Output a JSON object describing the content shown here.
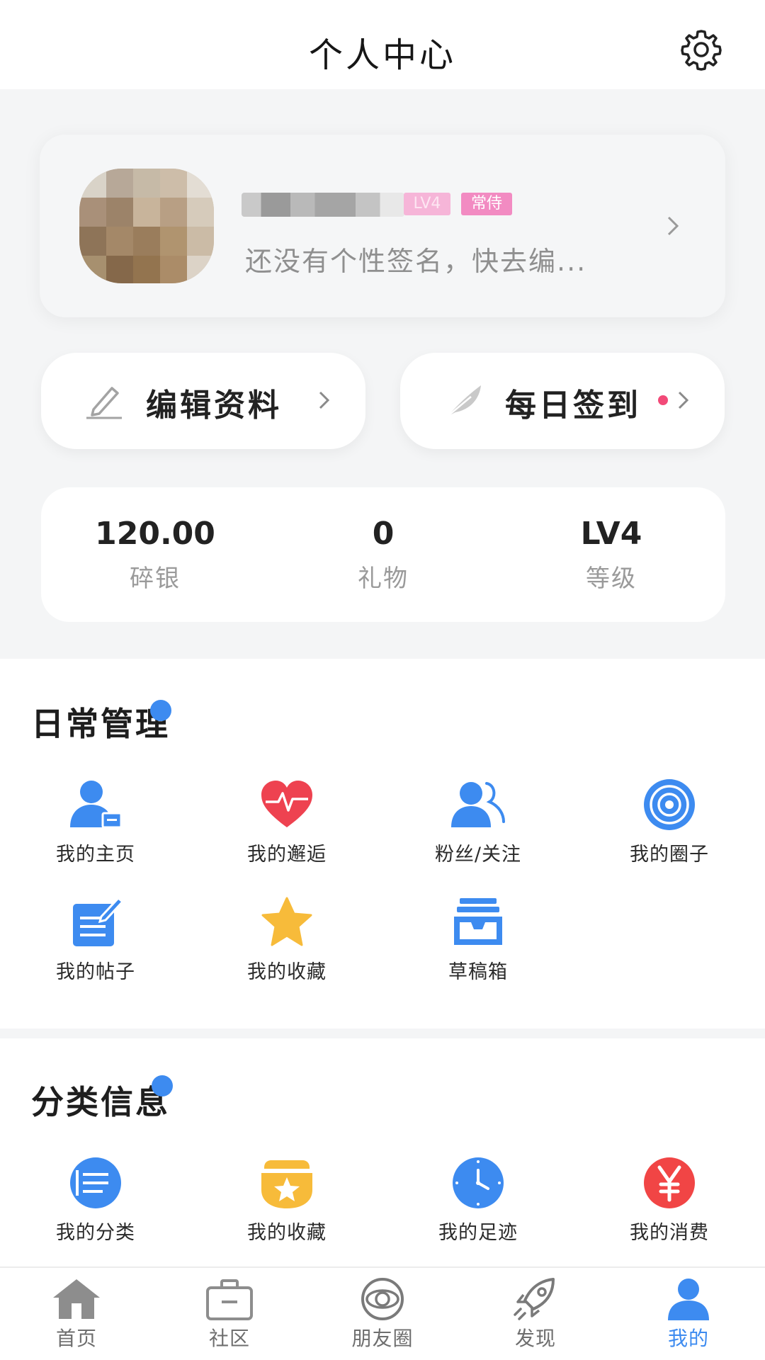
{
  "header": {
    "title": "个人中心"
  },
  "profile": {
    "level_badge": "LV4",
    "role_badge": "常侍",
    "signature": "还没有个性签名，快去编..."
  },
  "actions": {
    "edit_label": "编辑资料",
    "signin_label": "每日签到"
  },
  "stats": [
    {
      "value": "120.00",
      "label": "碎银"
    },
    {
      "value": "0",
      "label": "礼物"
    },
    {
      "value": "LV4",
      "label": "等级"
    }
  ],
  "daily": {
    "title": "日常管理",
    "items": [
      {
        "label": "我的主页",
        "icon": "user-home-icon"
      },
      {
        "label": "我的邂逅",
        "icon": "heart-pulse-icon"
      },
      {
        "label": "粉丝/关注",
        "icon": "followers-icon"
      },
      {
        "label": "我的圈子",
        "icon": "circle-target-icon"
      },
      {
        "label": "我的帖子",
        "icon": "post-edit-icon"
      },
      {
        "label": "我的收藏",
        "icon": "star-icon"
      },
      {
        "label": "草稿箱",
        "icon": "inbox-tray-icon"
      }
    ]
  },
  "category": {
    "title": "分类信息",
    "items": [
      {
        "label": "我的分类",
        "icon": "list-icon"
      },
      {
        "label": "我的收藏",
        "icon": "folder-star-icon"
      },
      {
        "label": "我的足迹",
        "icon": "clock-icon"
      },
      {
        "label": "我的消费",
        "icon": "yuan-icon"
      }
    ]
  },
  "tabbar": [
    {
      "label": "首页",
      "icon": "home-icon"
    },
    {
      "label": "社区",
      "icon": "briefcase-icon"
    },
    {
      "label": "朋友圈",
      "icon": "planet-icon"
    },
    {
      "label": "发现",
      "icon": "rocket-icon"
    },
    {
      "label": "我的",
      "icon": "user-icon",
      "active": true
    }
  ],
  "colors": {
    "accent": "#3d8bf0",
    "red_dot": "#f24a78",
    "badge_pink": "#f28bc2",
    "heart_red": "#ee4250",
    "star_yellow": "#f7bb3a",
    "yuan_red": "#f14545"
  }
}
